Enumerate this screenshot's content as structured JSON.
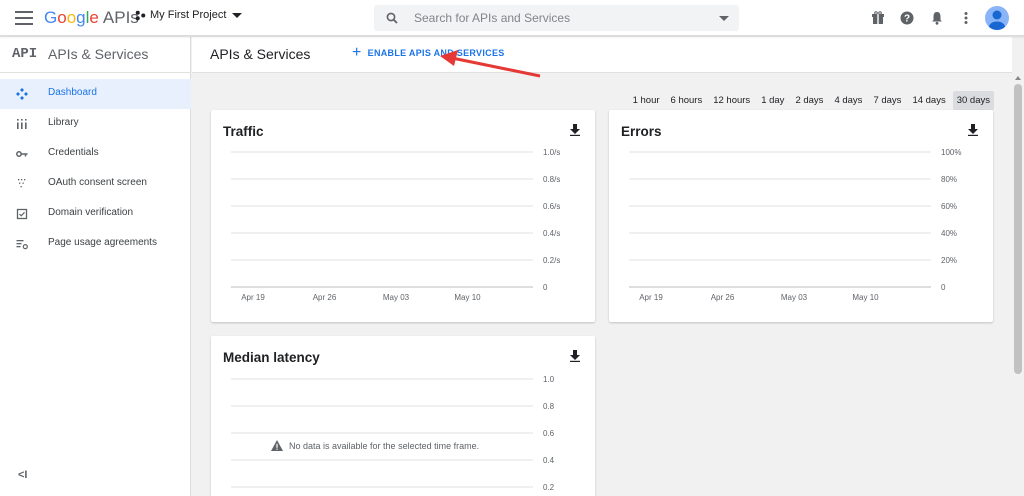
{
  "topbar": {
    "logo_google": [
      "G",
      "o",
      "o",
      "g",
      "l",
      "e"
    ],
    "logo_apis": "APIs",
    "project_name": "My First Project",
    "search_placeholder": "Search for APIs and Services"
  },
  "sidebar": {
    "logo_text": "API",
    "title": "APIs & Services",
    "items": [
      {
        "label": "Dashboard",
        "icon": "dashboard-icon",
        "active": true
      },
      {
        "label": "Library",
        "icon": "library-icon",
        "active": false
      },
      {
        "label": "Credentials",
        "icon": "key-icon",
        "active": false
      },
      {
        "label": "OAuth consent screen",
        "icon": "consent-icon",
        "active": false
      },
      {
        "label": "Domain verification",
        "icon": "checkbox-icon",
        "active": false
      },
      {
        "label": "Page usage agreements",
        "icon": "settings-list-icon",
        "active": false
      }
    ],
    "collapse_label": "<I"
  },
  "header": {
    "title": "APIs & Services",
    "enable_label": "ENABLE APIS AND SERVICES"
  },
  "time_ranges": [
    {
      "label": "1 hour",
      "selected": false
    },
    {
      "label": "6 hours",
      "selected": false
    },
    {
      "label": "12 hours",
      "selected": false
    },
    {
      "label": "1 day",
      "selected": false
    },
    {
      "label": "2 days",
      "selected": false
    },
    {
      "label": "4 days",
      "selected": false
    },
    {
      "label": "7 days",
      "selected": false
    },
    {
      "label": "14 days",
      "selected": false
    },
    {
      "label": "30 days",
      "selected": true
    }
  ],
  "colors": {
    "accent": "#1a73e8",
    "arrow": "#e53935",
    "grid": "#e0e0e0",
    "axis": "#bdbdbd"
  },
  "chart_data": [
    {
      "type": "line",
      "title": "Traffic",
      "x_ticks": [
        "Apr 19",
        "Apr 26",
        "May 03",
        "May 10"
      ],
      "y_ticks": [
        "1.0/s",
        "0.8/s",
        "0.6/s",
        "0.4/s",
        "0.2/s",
        "0"
      ],
      "ylim": [
        0,
        1.0
      ],
      "series": [],
      "grid": true
    },
    {
      "type": "line",
      "title": "Errors",
      "x_ticks": [
        "Apr 19",
        "Apr 26",
        "May 03",
        "May 10"
      ],
      "y_ticks": [
        "100%",
        "80%",
        "60%",
        "40%",
        "20%",
        "0"
      ],
      "ylim": [
        0,
        100
      ],
      "series": [],
      "grid": true
    },
    {
      "type": "line",
      "title": "Median latency",
      "x_ticks": [],
      "y_ticks": [
        "1.0",
        "0.8",
        "0.6",
        "0.4",
        "0.2"
      ],
      "ylim": [
        0,
        1.0
      ],
      "series": [],
      "grid": true,
      "message": "No data is available for the selected time frame."
    }
  ]
}
